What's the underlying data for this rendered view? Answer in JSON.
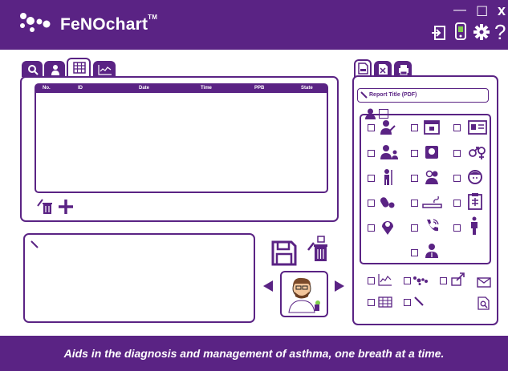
{
  "app": {
    "brand": "FeNOchart",
    "trademark": "TM",
    "footer_tagline": "Aids in the diagnosis and management of asthma, one breath at a time."
  },
  "window_controls": {
    "minimize": "—",
    "maximize": "☐",
    "close": "x",
    "help": "?"
  },
  "left_tabs": [
    {
      "icon": "search-icon",
      "active": false
    },
    {
      "icon": "patient-icon",
      "active": false
    },
    {
      "icon": "table-icon",
      "active": true
    },
    {
      "icon": "graph-icon",
      "active": false
    }
  ],
  "table": {
    "columns": [
      "No.",
      "ID",
      "Date",
      "Time",
      "PPB",
      "State"
    ],
    "rows": []
  },
  "right_tabs": [
    {
      "icon": "pdf-document-icon",
      "active": true
    },
    {
      "icon": "excel-document-icon",
      "active": false
    },
    {
      "icon": "printer-icon",
      "active": false
    }
  ],
  "report": {
    "title_placeholder": "Report Title (PDF)"
  },
  "colors": {
    "brand_purple": "#5a2384",
    "text_white": "#ffffff"
  }
}
